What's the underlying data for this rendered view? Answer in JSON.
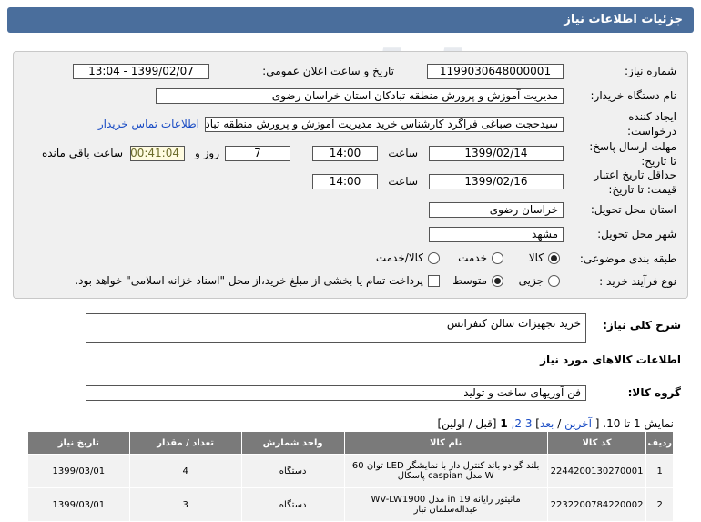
{
  "header": {
    "title": "جزئیات اطلاعات نیاز"
  },
  "form": {
    "need_number_label": "شماره نیاز:",
    "need_number": "1199030648000001",
    "announce_label": "تاریخ و ساعت اعلان عمومی:",
    "announce_value": "1399/02/07 - 13:04",
    "buyer_label": "نام دستگاه خریدار:",
    "buyer_value": "مدیریت آموزش و پرورش منطقه تبادکان استان خراسان رضوی",
    "creator_label_1": "ایجاد کننده",
    "creator_label_2": "درخواست:",
    "creator_value": "سیدحجت صباغی فراگرد کارشناس خرید مدیریت آموزش و پرورش منطقه تبادکان",
    "contact_link": "اطلاعات تماس خریدار",
    "reply_label_1": "مهلت ارسال پاسخ:",
    "reply_label_2": "تا تاریخ:",
    "reply_date": "1399/02/14",
    "time_label": "ساعت",
    "reply_time": "14:00",
    "days_value": "7",
    "days_label": "روز و",
    "remaining_value": "00:41:04",
    "remaining_label": "ساعت باقی مانده",
    "validity_label_1": "حداقل تاریخ اعتبار",
    "validity_label_2": "قیمت: تا تاریخ:",
    "validity_date": "1399/02/16",
    "validity_time": "14:00",
    "province_label": "استان محل تحویل:",
    "province_value": "خراسان رضوی",
    "city_label": "شهر محل تحویل:",
    "city_value": "مشهد",
    "category_label": "طبقه بندی موضوعی:",
    "category_options": [
      "کالا",
      "خدمت",
      "کالا/خدمت"
    ],
    "process_label": "نوع فرآیند خرید :",
    "process_options": [
      "جزیی",
      "متوسط"
    ],
    "payment_note": "پرداخت تمام یا بخشی از مبلغ خرید،از محل \"اسناد خزانه اسلامی\" خواهد بود."
  },
  "summary": {
    "label": "شرح کلی نیاز:",
    "value": "خرید تجهیزات سالن کنفرانس"
  },
  "goods_info_title": "اطلاعات کالاهای مورد نیاز",
  "goods_group": {
    "label": "گروه کالا:",
    "value": "فن آوریهای ساخت و تولید"
  },
  "pager": {
    "prefix": "نمایش 1 تا 10. [",
    "last": "آخرین",
    "next": "بعد",
    "pages": [
      "3",
      "2,"
    ],
    "current": "1",
    "suffix": "[قبل / اولین]"
  },
  "table": {
    "headers": [
      "ردیف",
      "کد کالا",
      "نام کالا",
      "واحد شمارش",
      "تعداد / مقدار",
      "تاریخ نیاز"
    ],
    "rows": [
      [
        "1",
        "2244200130270001",
        "بلند گو دو باند کنترل دار با نمایشگر LED توان 60 W مدل caspian پاسکال",
        "دستگاه",
        "4",
        "1399/03/01"
      ],
      [
        "2",
        "2232200784220002",
        "مانیتور رایانه 19 in مدل WV-LW1900 عبداله‌سلمان تبار",
        "دستگاه",
        "3",
        "1399/03/01"
      ]
    ]
  },
  "colors": {
    "header_bg": "#4a6e9c",
    "link": "#1a4cc4",
    "table_header": "#7a7a7a"
  }
}
